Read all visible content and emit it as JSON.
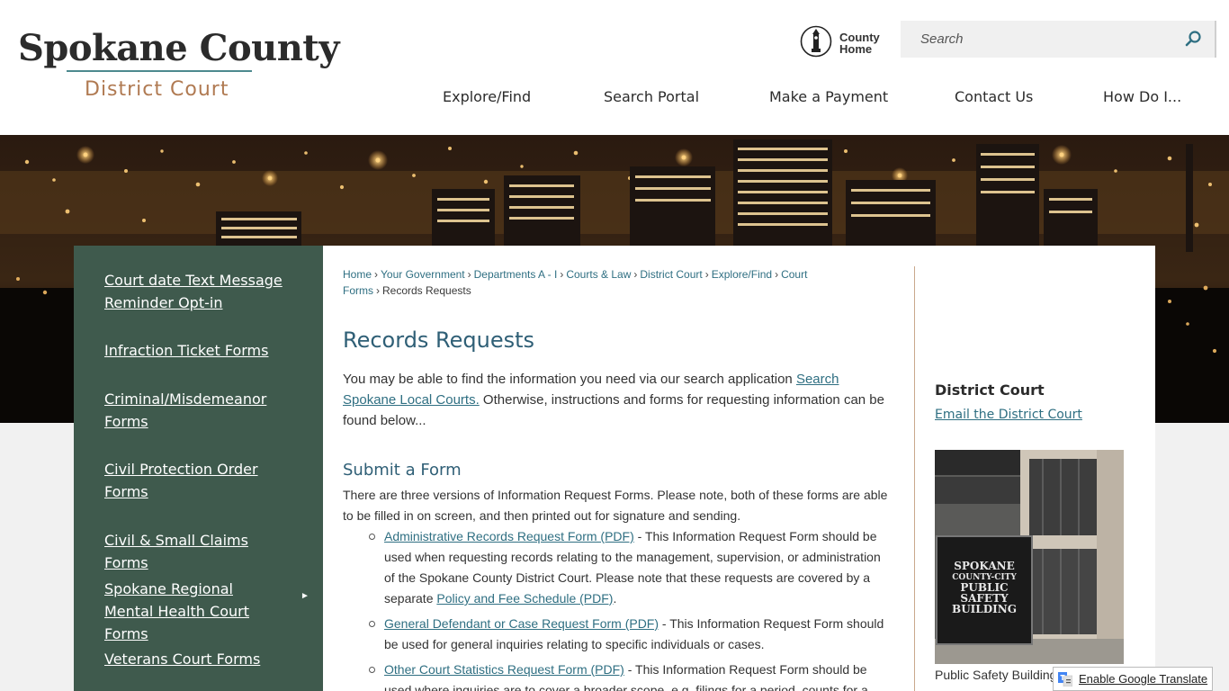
{
  "header": {
    "logo_title": "Spokane County",
    "logo_subtitle": "District Court",
    "county_home_label": "County Home",
    "search_placeholder": "Search"
  },
  "nav": {
    "items": [
      {
        "label": "Explore/Find"
      },
      {
        "label": "Search Portal"
      },
      {
        "label": "Make a Payment"
      },
      {
        "label": "Contact Us"
      },
      {
        "label": "How Do I..."
      }
    ]
  },
  "sidebar": {
    "items": [
      {
        "label": "Court date Text Message Reminder Opt-in"
      },
      {
        "label": "Infraction Ticket Forms"
      },
      {
        "label": "Criminal/Misdemeanor Forms"
      },
      {
        "label": "Civil Protection Order Forms"
      },
      {
        "label": "Civil & Small Claims Forms"
      },
      {
        "label": "Spokane Regional Mental Health Court Forms"
      },
      {
        "label": "Veterans Court Forms"
      }
    ],
    "arrow": "►"
  },
  "breadcrumb": {
    "items": [
      {
        "label": "Home"
      },
      {
        "label": "Your Government"
      },
      {
        "label": "Departments A - I"
      },
      {
        "label": "Courts & Law"
      },
      {
        "label": "District Court"
      },
      {
        "label": "Explore/Find"
      },
      {
        "label": "Court Forms"
      }
    ],
    "current": "Records Requests",
    "separator": "›"
  },
  "content": {
    "title": "Records Requests",
    "intro_prefix": "You may be able to find the information you need via our search application ",
    "intro_link": "Search Spokane Local Courts.",
    "intro_suffix": " Otherwise, instructions and forms for requesting information can be found below...",
    "section_title": "Submit a Form",
    "section_text": "There are three versions of Information Request Forms. Please note, both of these forms are able to be filled in on screen, and then printed out for signature and sending.",
    "bullets": [
      {
        "link": "Administrative Records Request Form (PDF)",
        "text": " - This Information Request Form should be used when requesting records relating to the management, supervision, or administration of the Spokane County District Court. Please note that these requests are covered by a separate ",
        "link2": "Policy and Fee Schedule (PDF)",
        "text2": "."
      },
      {
        "link": "General Defendant or Case Request Form (PDF)",
        "text": " - This Information Request Form should be used for general inquiries relating to specific individuals or cases."
      },
      {
        "link": "Other Court Statistics Request Form (PDF)",
        "text": " - This Information Request Form should be used where inquiries are to cover a broader scope, e.g. filings for a period, counts for a"
      }
    ]
  },
  "right_column": {
    "title": "District Court",
    "email_link": "Email the District Court",
    "photo_sign": [
      "SPOKANE",
      "COUNTY-CITY",
      "PUBLIC",
      "SAFETY",
      "BUILDING"
    ],
    "caption": "Public Safety Building"
  },
  "translate": {
    "label": "Enable Google Translate"
  },
  "colors": {
    "sidebar_bg": "#3f5a4d",
    "link": "#2f6f82",
    "heading": "#2f5f76",
    "logo_subtitle": "#b07a52"
  }
}
